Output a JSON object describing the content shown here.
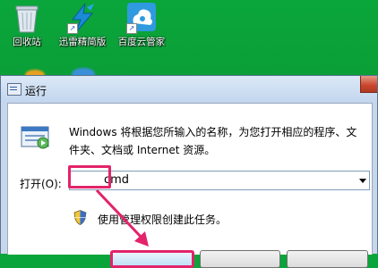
{
  "desktop": {
    "icons": [
      {
        "label": "回收站",
        "icon": "recycle-bin-icon"
      },
      {
        "label": "迅雷精简版",
        "icon": "thunder-icon"
      },
      {
        "label": "百度云管家",
        "icon": "baidu-cloud-icon"
      }
    ]
  },
  "dialog": {
    "title": "运行",
    "description": "Windows 将根据您所输入的名称，为您打开相应的程序、文件夹、文档或 Internet 资源。",
    "open_label": "打开(O):",
    "input_value": "cmd",
    "admin_note": "使用管理权限创建此任务。"
  },
  "colors": {
    "highlight": "#e3236a",
    "desktop": "#0aa63b"
  }
}
